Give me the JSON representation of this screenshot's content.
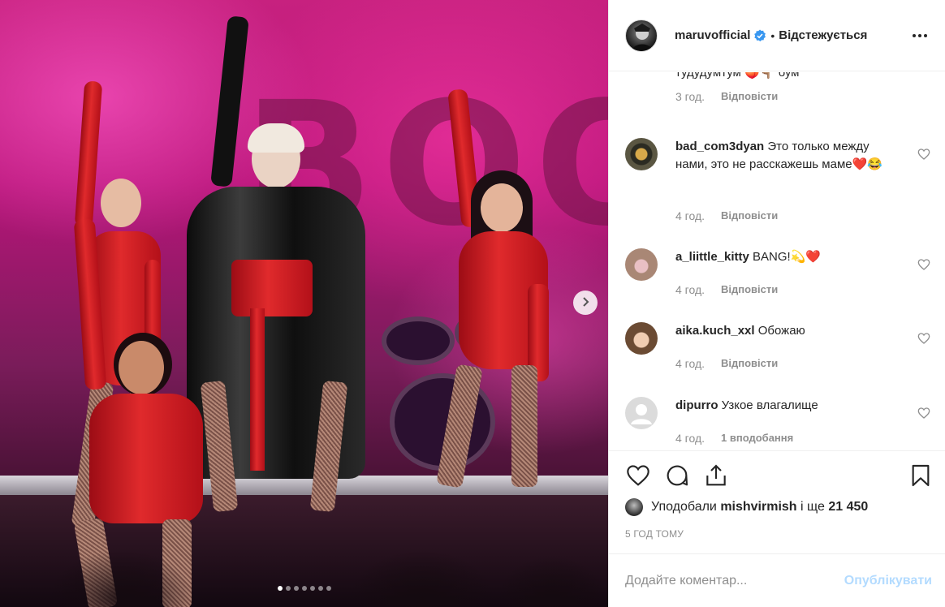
{
  "post": {
    "username": "maruvofficial",
    "verified": true,
    "follow_status": "Відстежується",
    "dot": "•"
  },
  "media": {
    "background_word": "BOO",
    "carousel_dots": 7,
    "active_dot": 0
  },
  "comments": [
    {
      "username": "",
      "text": "тудудумтум 🍑👇🏽 бум",
      "time": "3 год.",
      "reply": "Відповісти",
      "likes": "",
      "avatar_color": "#ffffff"
    },
    {
      "username": "bad_com3dyan",
      "text": "Это только между нами, это не расскажешь маме❤️😂",
      "time": "4 год.",
      "reply": "Відповісти",
      "likes": "",
      "avatar_color": "#3c3a2c"
    },
    {
      "username": "a_liittle_kitty",
      "text": "BANG!💫❤️",
      "time": "4 год.",
      "reply": "Відповісти",
      "likes": "",
      "avatar_color": "#c99b8a"
    },
    {
      "username": "aika.kuch_xxl",
      "text": "Обожаю",
      "time": "4 год.",
      "reply": "Відповісти",
      "likes": "",
      "avatar_color": "#b58b63"
    },
    {
      "username": "dipurro",
      "text": "Узкое влагалище",
      "time": "4 год.",
      "reply": "",
      "likes": "1 вподобання",
      "avatar_color": "#dbdbdb"
    }
  ],
  "likes": {
    "prefix": "Уподобали",
    "user": "mishvirmish",
    "conj": "і ще",
    "count": "21 450"
  },
  "time_ago": "5 ГОД ТОМУ",
  "add_comment": {
    "placeholder": "Додайте коментар...",
    "publish_label": "Опублікувати"
  },
  "colors": {
    "verified_blue": "#3897f0",
    "publish_disabled": "#b3dbff",
    "meta_gray": "#8e8e8e"
  }
}
